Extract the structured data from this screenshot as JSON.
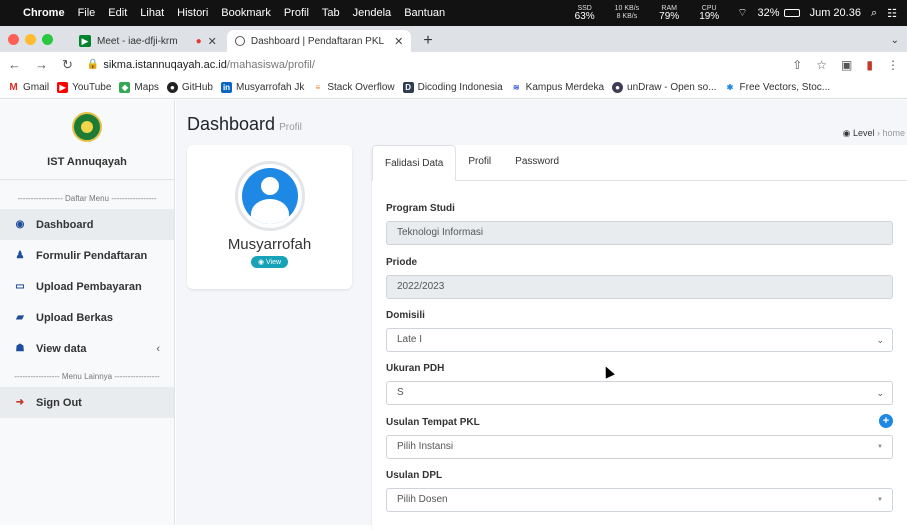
{
  "os_menu": {
    "apple": "",
    "items": [
      "Chrome",
      "File",
      "Edit",
      "Lihat",
      "Histori",
      "Bookmark",
      "Profil",
      "Tab",
      "Jendela",
      "Bantuan"
    ],
    "status": {
      "sys1": "SSD",
      "sys1_val": "63%",
      "net_up": "10 KB/s",
      "net_down": "8 KB/s",
      "ram_label": "RAM",
      "ram": "79%",
      "cpu_label": "CPU",
      "cpu": "19%",
      "battery": "32%",
      "clock": "Jum 20.36"
    }
  },
  "tabs": [
    {
      "label": "Meet - iae-dfji-krm"
    },
    {
      "label": ""
    },
    {
      "label": "Dashboard | Pendaftaran PKL"
    }
  ],
  "address": {
    "host": "sikma.istannuqayah.ac.id",
    "path": "/mahasiswa/profil/"
  },
  "bookmarks": [
    "Gmail",
    "YouTube",
    "Maps",
    "GitHub",
    "Musyarrofah Jk",
    "Stack Overflow",
    "Dicoding Indonesia",
    "Kampus Merdeka",
    "unDraw - Open so...",
    "Free Vectors, Stoc..."
  ],
  "sidebar": {
    "brand": "IST Annuqayah",
    "sep_main": "----------------- Daftar Menu -----------------",
    "items": [
      {
        "label": "Dashboard",
        "icon": "tachometer-icon"
      },
      {
        "label": "Formulir Pendaftaran",
        "icon": "user-icon"
      },
      {
        "label": "Upload Pembayaran",
        "icon": "money-icon"
      },
      {
        "label": "Upload Berkas",
        "icon": "book-icon"
      },
      {
        "label": "View data",
        "icon": "users-icon"
      }
    ],
    "sep_other": "----------------- Menu Lainnya -----------------",
    "signout": "Sign Out"
  },
  "page": {
    "title": "Dashboard",
    "subtitle": "Profil",
    "crumb_level": "Level",
    "crumb_home": "home"
  },
  "profile": {
    "name": "Musyarrofah",
    "view_label": "View"
  },
  "form_tabs": [
    "Falidasi Data",
    "Profil",
    "Password"
  ],
  "fields": {
    "program_studi": {
      "label": "Program Studi",
      "value": "Teknologi Informasi"
    },
    "priode": {
      "label": "Priode",
      "value": "2022/2023"
    },
    "domisili": {
      "label": "Domisili",
      "value": "Late I"
    },
    "ukuran_pdh": {
      "label": "Ukuran PDH",
      "value": "S"
    },
    "usulan_tempat": {
      "label": "Usulan Tempat PKL",
      "value": "Pilih Instansi"
    },
    "usulan_dpl": {
      "label": "Usulan DPL",
      "value": "Pilih Dosen"
    }
  },
  "colors": {
    "accent": "#1e88e5",
    "info": "#17a2b8",
    "sidebar_bg": "#f8f9fa"
  }
}
